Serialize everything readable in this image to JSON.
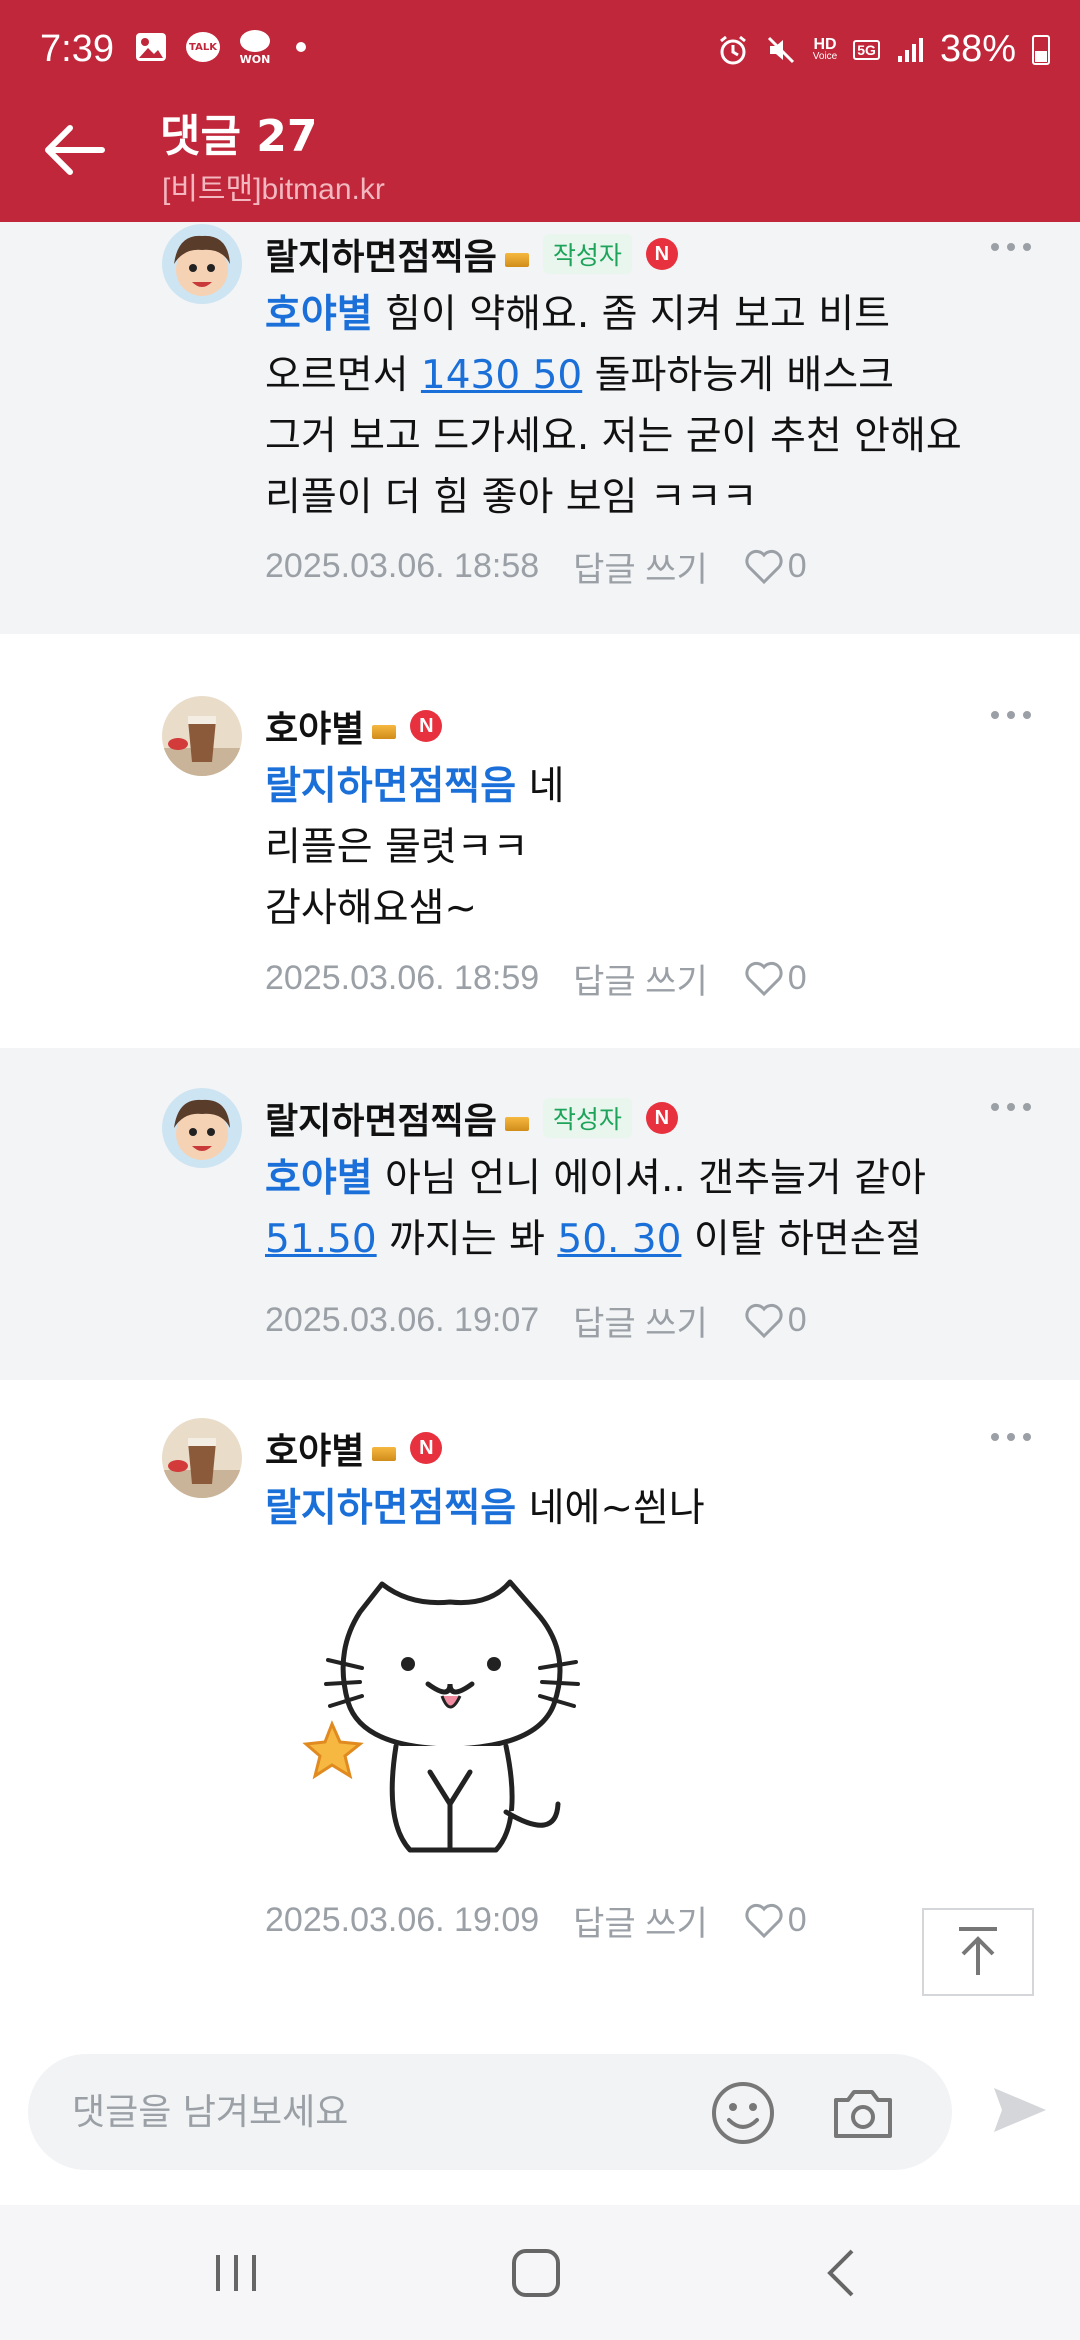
{
  "status_bar": {
    "time": "7:39",
    "battery": "38%",
    "icons": [
      "gallery-icon",
      "kakaotalk-icon",
      "won-icon",
      "alarm-icon",
      "mute-icon",
      "hd-voice-icon",
      "5g-icon",
      "signal-icon",
      "battery-icon"
    ],
    "talk_label": "TALK",
    "won_label": "WON",
    "hd_label": "HD",
    "voice_label": "Voice",
    "g5_label": "5G"
  },
  "header": {
    "title": "댓글 27",
    "subtitle": "[비트맨]bitman.kr",
    "bg_color": "#c0273a"
  },
  "comments": [
    {
      "author": "랄지하면점찍음",
      "writer_badge": "작성자",
      "new_badge": "N",
      "mention": "호야별",
      "text_lines": [
        {
          "segments": [
            {
              "t": "mention",
              "v": "호야별"
            },
            {
              "t": "text",
              "v": " 힘이 약해요. 좀 지켜 보고 비트"
            }
          ]
        },
        {
          "segments": [
            {
              "t": "text",
              "v": "오르면서 "
            },
            {
              "t": "link",
              "v": "1430 50"
            },
            {
              "t": "text",
              "v": " 돌파하능게 배스크"
            }
          ]
        },
        {
          "segments": [
            {
              "t": "text",
              "v": "그거 보고 드가세요. 저는 굳이 추천 안해요"
            }
          ]
        },
        {
          "segments": [
            {
              "t": "text",
              "v": "리플이 더 힘 좋아 보임 ㅋㅋㅋ"
            }
          ]
        }
      ],
      "date": "2025.03.06. 18:58",
      "reply_label": "답글 쓰기",
      "likes": "0"
    },
    {
      "author": "호야별",
      "writer_badge": "",
      "new_badge": "N",
      "text_lines": [
        {
          "segments": [
            {
              "t": "mention",
              "v": "랄지하면점찍음"
            },
            {
              "t": "text",
              "v": " 네"
            }
          ]
        },
        {
          "segments": [
            {
              "t": "text",
              "v": "리플은 물렷ㅋㅋ"
            }
          ]
        },
        {
          "segments": [
            {
              "t": "text",
              "v": "감사해요샘~"
            }
          ]
        }
      ],
      "date": "2025.03.06. 18:59",
      "reply_label": "답글 쓰기",
      "likes": "0"
    },
    {
      "author": "랄지하면점찍음",
      "writer_badge": "작성자",
      "new_badge": "N",
      "text_lines": [
        {
          "segments": [
            {
              "t": "mention",
              "v": "호야별"
            },
            {
              "t": "text",
              "v": " 아님 언니 에이셔.. 갠추늘거 같아"
            }
          ]
        },
        {
          "segments": [
            {
              "t": "link",
              "v": "51.50"
            },
            {
              "t": "text",
              "v": " 까지는 봐 "
            },
            {
              "t": "link",
              "v": "50. 30"
            },
            {
              "t": "text",
              "v": " 이탈 하면손절"
            }
          ]
        }
      ],
      "date": "2025.03.06. 19:07",
      "reply_label": "답글 쓰기",
      "likes": "0"
    },
    {
      "author": "호야별",
      "writer_badge": "",
      "new_badge": "N",
      "text_lines": [
        {
          "segments": [
            {
              "t": "mention",
              "v": "랄지하면점찍음"
            },
            {
              "t": "text",
              "v": " 네에~씐나"
            }
          ]
        }
      ],
      "sticker": "cat-sticker",
      "date": "2025.03.06. 19:09",
      "reply_label": "답글 쓰기",
      "likes": "0"
    }
  ],
  "input": {
    "placeholder": "댓글을 남겨보세요"
  },
  "nav": {
    "buttons": [
      "recents-icon",
      "home-icon",
      "back-icon"
    ]
  }
}
